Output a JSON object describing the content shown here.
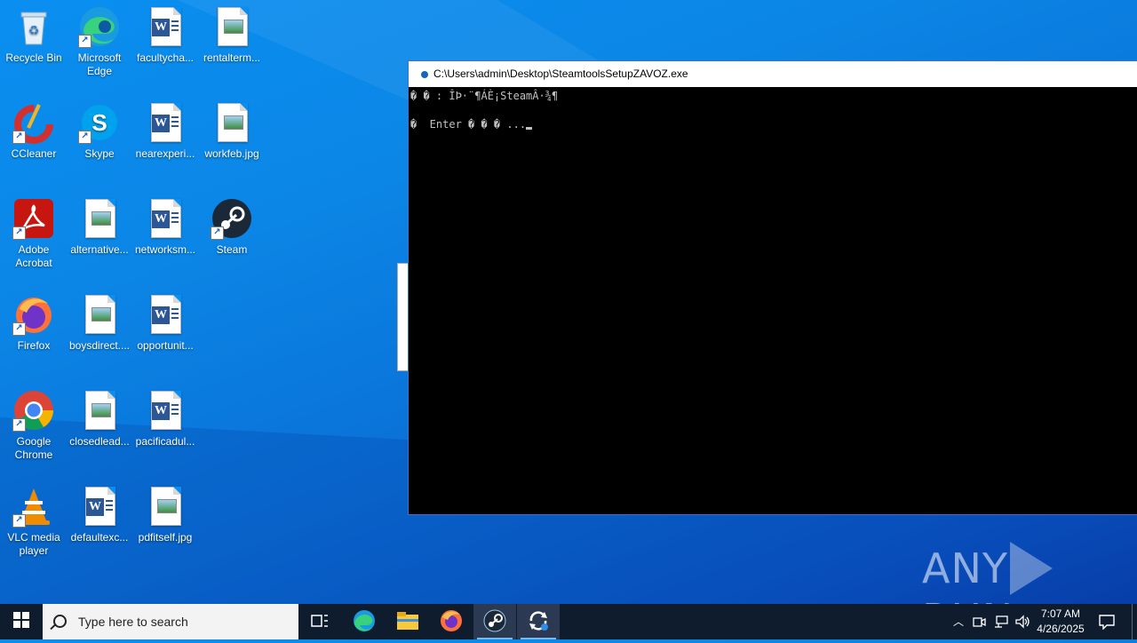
{
  "desktop": {
    "icons": [
      {
        "label": "Recycle Bin",
        "icon": "recycle-bin-icon"
      },
      {
        "label": "Microsoft Edge",
        "icon": "edge-icon"
      },
      {
        "label": "facultycha...",
        "icon": "word-document-icon"
      },
      {
        "label": "rentalterm...",
        "icon": "image-file-icon"
      },
      {
        "label": "CCleaner",
        "icon": "ccleaner-icon"
      },
      {
        "label": "Skype",
        "icon": "skype-icon"
      },
      {
        "label": "nearexperi...",
        "icon": "word-document-icon"
      },
      {
        "label": "workfeb.jpg",
        "icon": "image-file-icon"
      },
      {
        "label": "Adobe Acrobat",
        "icon": "acrobat-icon"
      },
      {
        "label": "alternative...",
        "icon": "image-file-icon"
      },
      {
        "label": "networksm...",
        "icon": "word-document-icon"
      },
      {
        "label": "Steam",
        "icon": "steam-icon"
      },
      {
        "label": "Firefox",
        "icon": "firefox-icon"
      },
      {
        "label": "boysdirect....",
        "icon": "image-file-icon"
      },
      {
        "label": "opportunit...",
        "icon": "word-document-icon"
      },
      {
        "label": "Google Chrome",
        "icon": "chrome-icon"
      },
      {
        "label": "closedlead...",
        "icon": "image-file-icon"
      },
      {
        "label": "pacificadul...",
        "icon": "word-document-icon"
      },
      {
        "label": "VLC media player",
        "icon": "vlc-icon"
      },
      {
        "label": "defaultexc...",
        "icon": "word-document-icon"
      },
      {
        "label": "pdfitself.jpg",
        "icon": "image-file-icon"
      }
    ]
  },
  "console": {
    "title": "C:\\Users\\admin\\Desktop\\SteamtoolsSetupZAVOZ.exe",
    "line1": "� � : ÎÞ·¨¶ÁÈ¡SteamÂ·¾¶",
    "line2": "",
    "line3": "�  Enter � � � ..."
  },
  "watermark": {
    "left": "ANY",
    "right": "RUN"
  },
  "taskbar": {
    "search_placeholder": "Type here to search",
    "time": "7:07 AM",
    "date": "4/26/2025",
    "apps": [
      "task-view-icon",
      "edge-icon",
      "file-explorer-icon",
      "firefox-icon",
      "steam-icon",
      "steamtools-icon"
    ]
  },
  "colors": {
    "desktop": "#0a8ff0",
    "taskbar": "#0f1c2e",
    "console_bg": "#000000",
    "console_text": "#c0c0c0"
  }
}
